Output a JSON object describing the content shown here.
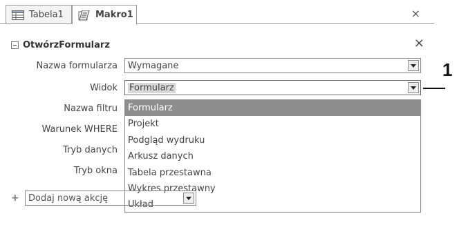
{
  "tabs": [
    {
      "label": "Tabela1",
      "icon": "table-icon"
    },
    {
      "label": "Makro1",
      "icon": "macro-icon"
    }
  ],
  "tab_close": "×",
  "action": {
    "name": "OtwórzFormularz",
    "close": "×"
  },
  "fields": {
    "form_name_label": "Nazwa formularza",
    "form_name_value": "Wymagane",
    "view_label": "Widok",
    "view_value": "Formularz",
    "filter_label": "Nazwa filtru",
    "where_label": "Warunek WHERE",
    "data_mode_label": "Tryb danych",
    "window_mode_label": "Tryb okna"
  },
  "view_options": [
    "Formularz",
    "Projekt",
    "Podgląd wydruku",
    "Arkusz danych",
    "Tabela przestawna",
    "Wykres przestawny",
    "Układ"
  ],
  "add_action": {
    "placeholder": "Dodaj nową akcję",
    "icon": "plus-icon"
  },
  "callout": "1"
}
